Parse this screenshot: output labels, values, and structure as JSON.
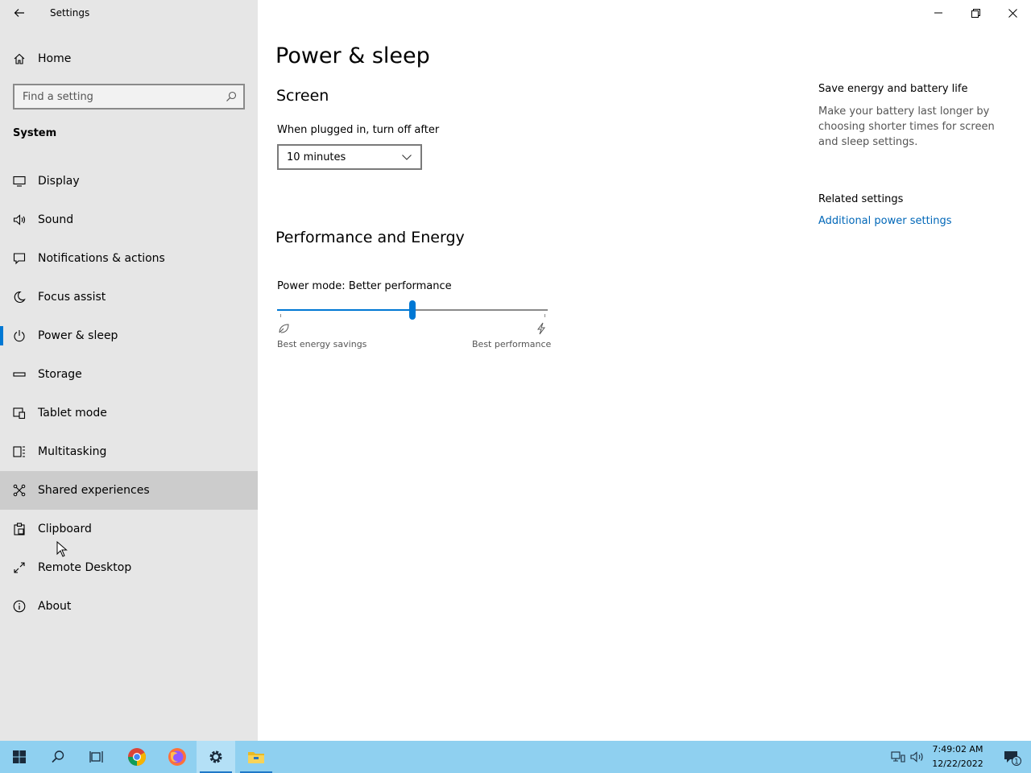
{
  "app": {
    "title": "Settings"
  },
  "sidebar": {
    "home_label": "Home",
    "search_placeholder": "Find a setting",
    "section_title": "System",
    "items": [
      {
        "label": "Display",
        "icon": "display-icon"
      },
      {
        "label": "Sound",
        "icon": "speaker-icon"
      },
      {
        "label": "Notifications & actions",
        "icon": "notification-icon"
      },
      {
        "label": "Focus assist",
        "icon": "moon-icon"
      },
      {
        "label": "Power & sleep",
        "icon": "power-icon",
        "active": true
      },
      {
        "label": "Storage",
        "icon": "storage-icon"
      },
      {
        "label": "Tablet mode",
        "icon": "tablet-mode-icon"
      },
      {
        "label": "Multitasking",
        "icon": "multitasking-icon"
      },
      {
        "label": "Shared experiences",
        "icon": "shared-experiences-icon",
        "hover": true
      },
      {
        "label": "Clipboard",
        "icon": "clipboard-icon"
      },
      {
        "label": "Remote Desktop",
        "icon": "remote-desktop-icon"
      },
      {
        "label": "About",
        "icon": "info-icon"
      }
    ]
  },
  "main": {
    "title": "Power & sleep",
    "screen": {
      "heading": "Screen",
      "plugged_label": "When plugged in, turn off after",
      "plugged_value": "10 minutes"
    },
    "performance": {
      "heading": "Performance and Energy",
      "mode_label": "Power mode: Better performance",
      "slider_position": 0.5,
      "left_label": "Best energy savings",
      "right_label": "Best performance"
    }
  },
  "right": {
    "save_title": "Save energy and battery life",
    "save_text": "Make your battery last longer by choosing shorter times for screen and sleep settings.",
    "related_title": "Related settings",
    "related_link": "Additional power settings"
  },
  "taskbar": {
    "time": "7:49:02 AM",
    "date": "12/22/2022",
    "notification_count": "1"
  },
  "colors": {
    "accent": "#0078d4",
    "link": "#0067b8",
    "sidebar_bg": "#e6e6e6",
    "taskbar_bg": "#8fd0f0"
  }
}
